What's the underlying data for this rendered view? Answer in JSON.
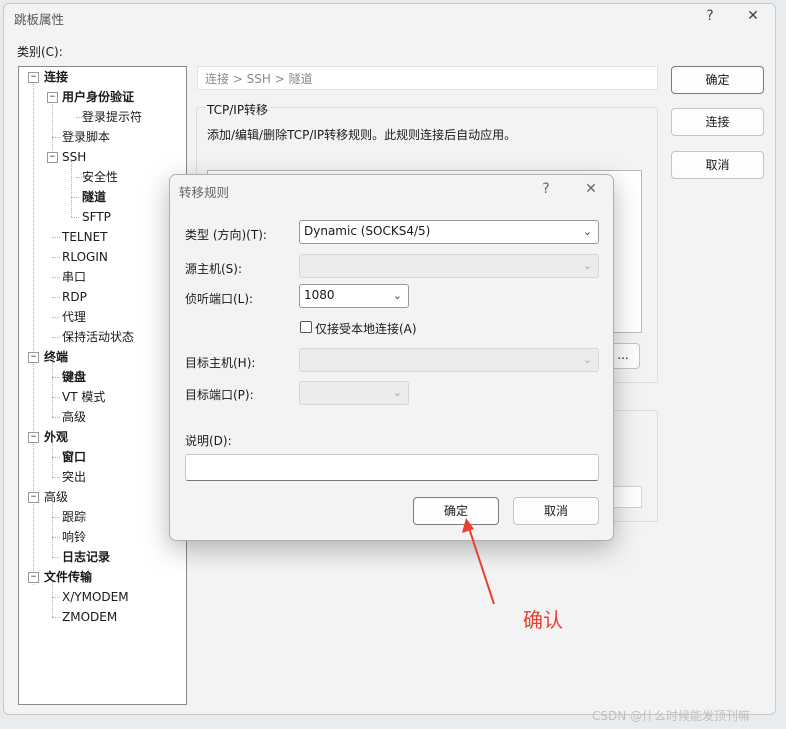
{
  "window": {
    "title": "跳板属性",
    "help": "?",
    "close": "✕"
  },
  "category_label": "类别(C):",
  "tree": [
    {
      "label": "连接",
      "bold": true
    },
    {
      "label": "用户身份验证",
      "bold": true
    },
    {
      "label": "登录提示符",
      "bold": false
    },
    {
      "label": "登录脚本",
      "bold": false
    },
    {
      "label": "SSH",
      "bold": false
    },
    {
      "label": "安全性",
      "bold": false
    },
    {
      "label": "隧道",
      "bold": true
    },
    {
      "label": "SFTP",
      "bold": false
    },
    {
      "label": "TELNET",
      "bold": false
    },
    {
      "label": "RLOGIN",
      "bold": false
    },
    {
      "label": "串口",
      "bold": false
    },
    {
      "label": "RDP",
      "bold": false
    },
    {
      "label": "代理",
      "bold": false
    },
    {
      "label": "保持活动状态",
      "bold": false
    },
    {
      "label": "终端",
      "bold": true
    },
    {
      "label": "键盘",
      "bold": true
    },
    {
      "label": "VT 模式",
      "bold": false
    },
    {
      "label": "高级",
      "bold": false
    },
    {
      "label": "外观",
      "bold": true
    },
    {
      "label": "窗口",
      "bold": true
    },
    {
      "label": "突出",
      "bold": false
    },
    {
      "label": "高级",
      "bold": false
    },
    {
      "label": "跟踪",
      "bold": false
    },
    {
      "label": "响铃",
      "bold": false
    },
    {
      "label": "日志记录",
      "bold": true
    },
    {
      "label": "文件传输",
      "bold": true
    },
    {
      "label": "X/YMODEM",
      "bold": false
    },
    {
      "label": "ZMODEM",
      "bold": false
    }
  ],
  "toggles": {
    "expanded": "−"
  },
  "breadcrumb": "连接 > SSH > 隧道",
  "tcpip": {
    "group_title": "TCP/IP转移",
    "description": "添加/编辑/删除TCP/IP转移规则。此规则连接后自动应用。",
    "more": "..."
  },
  "side_buttons": {
    "ok": "确定",
    "connect": "连接",
    "cancel": "取消"
  },
  "dialog": {
    "title": "转移规则",
    "help": "?",
    "close": "✕",
    "type_label": "类型 (方向)(T):",
    "type_value": "Dynamic (SOCKS4/5)",
    "source_host_label": "源主机(S):",
    "source_host_value": "",
    "listen_port_label": "侦听端口(L):",
    "listen_port_value": "1080",
    "local_only_label": "仅接受本地连接(A)",
    "target_host_label": "目标主机(H):",
    "target_host_value": "",
    "target_port_label": "目标端口(P):",
    "target_port_value": "",
    "desc_label": "说明(D):",
    "desc_value": "",
    "ok": "确定",
    "cancel": "取消"
  },
  "annotation": {
    "text": "确认",
    "color": "#e8402e"
  },
  "watermark": "CSDN @什么时候能发顶刊嘛",
  "icons": {
    "chevron": "chevron-down-icon"
  }
}
